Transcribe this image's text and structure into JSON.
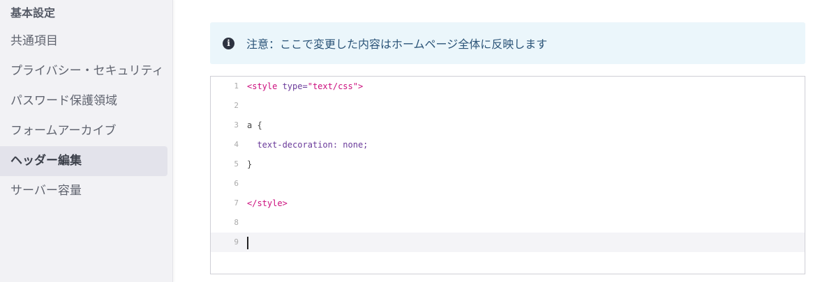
{
  "sidebar": {
    "section_title": "基本設定",
    "items": [
      {
        "label": "共通項目",
        "active": false
      },
      {
        "label": "プライバシー・セキュリティ",
        "active": false
      },
      {
        "label": "パスワード保護領域",
        "active": false
      },
      {
        "label": "フォームアーカイブ",
        "active": false
      },
      {
        "label": "ヘッダー編集",
        "active": true
      },
      {
        "label": "サーバー容量",
        "active": false
      }
    ]
  },
  "notice": {
    "icon": "info-icon",
    "icon_glyph": "i",
    "message": "注意：ここで変更した内容はホームページ全体に反映します"
  },
  "editor": {
    "line_numbers": [
      "1",
      "2",
      "3",
      "4",
      "5",
      "6",
      "7",
      "8",
      "9"
    ],
    "current_line": 9,
    "lines": [
      {
        "t1": "<style",
        "t2": " type=",
        "t3": "\"text/css\"",
        "t4": ">"
      },
      {
        "text": ""
      },
      {
        "text": "a {"
      },
      {
        "prop": "  text-decoration",
        "rest": ": none;"
      },
      {
        "text": "}"
      },
      {
        "text": ""
      },
      {
        "tag": "</style>"
      },
      {
        "text": ""
      },
      {
        "text": ""
      }
    ]
  },
  "colors": {
    "tag": "#cc0f7e",
    "attr": "#6a3a9a",
    "notice_bg": "#ebf6fb",
    "notice_text": "#2b5478",
    "sidebar_bg": "#f2f2f5"
  }
}
